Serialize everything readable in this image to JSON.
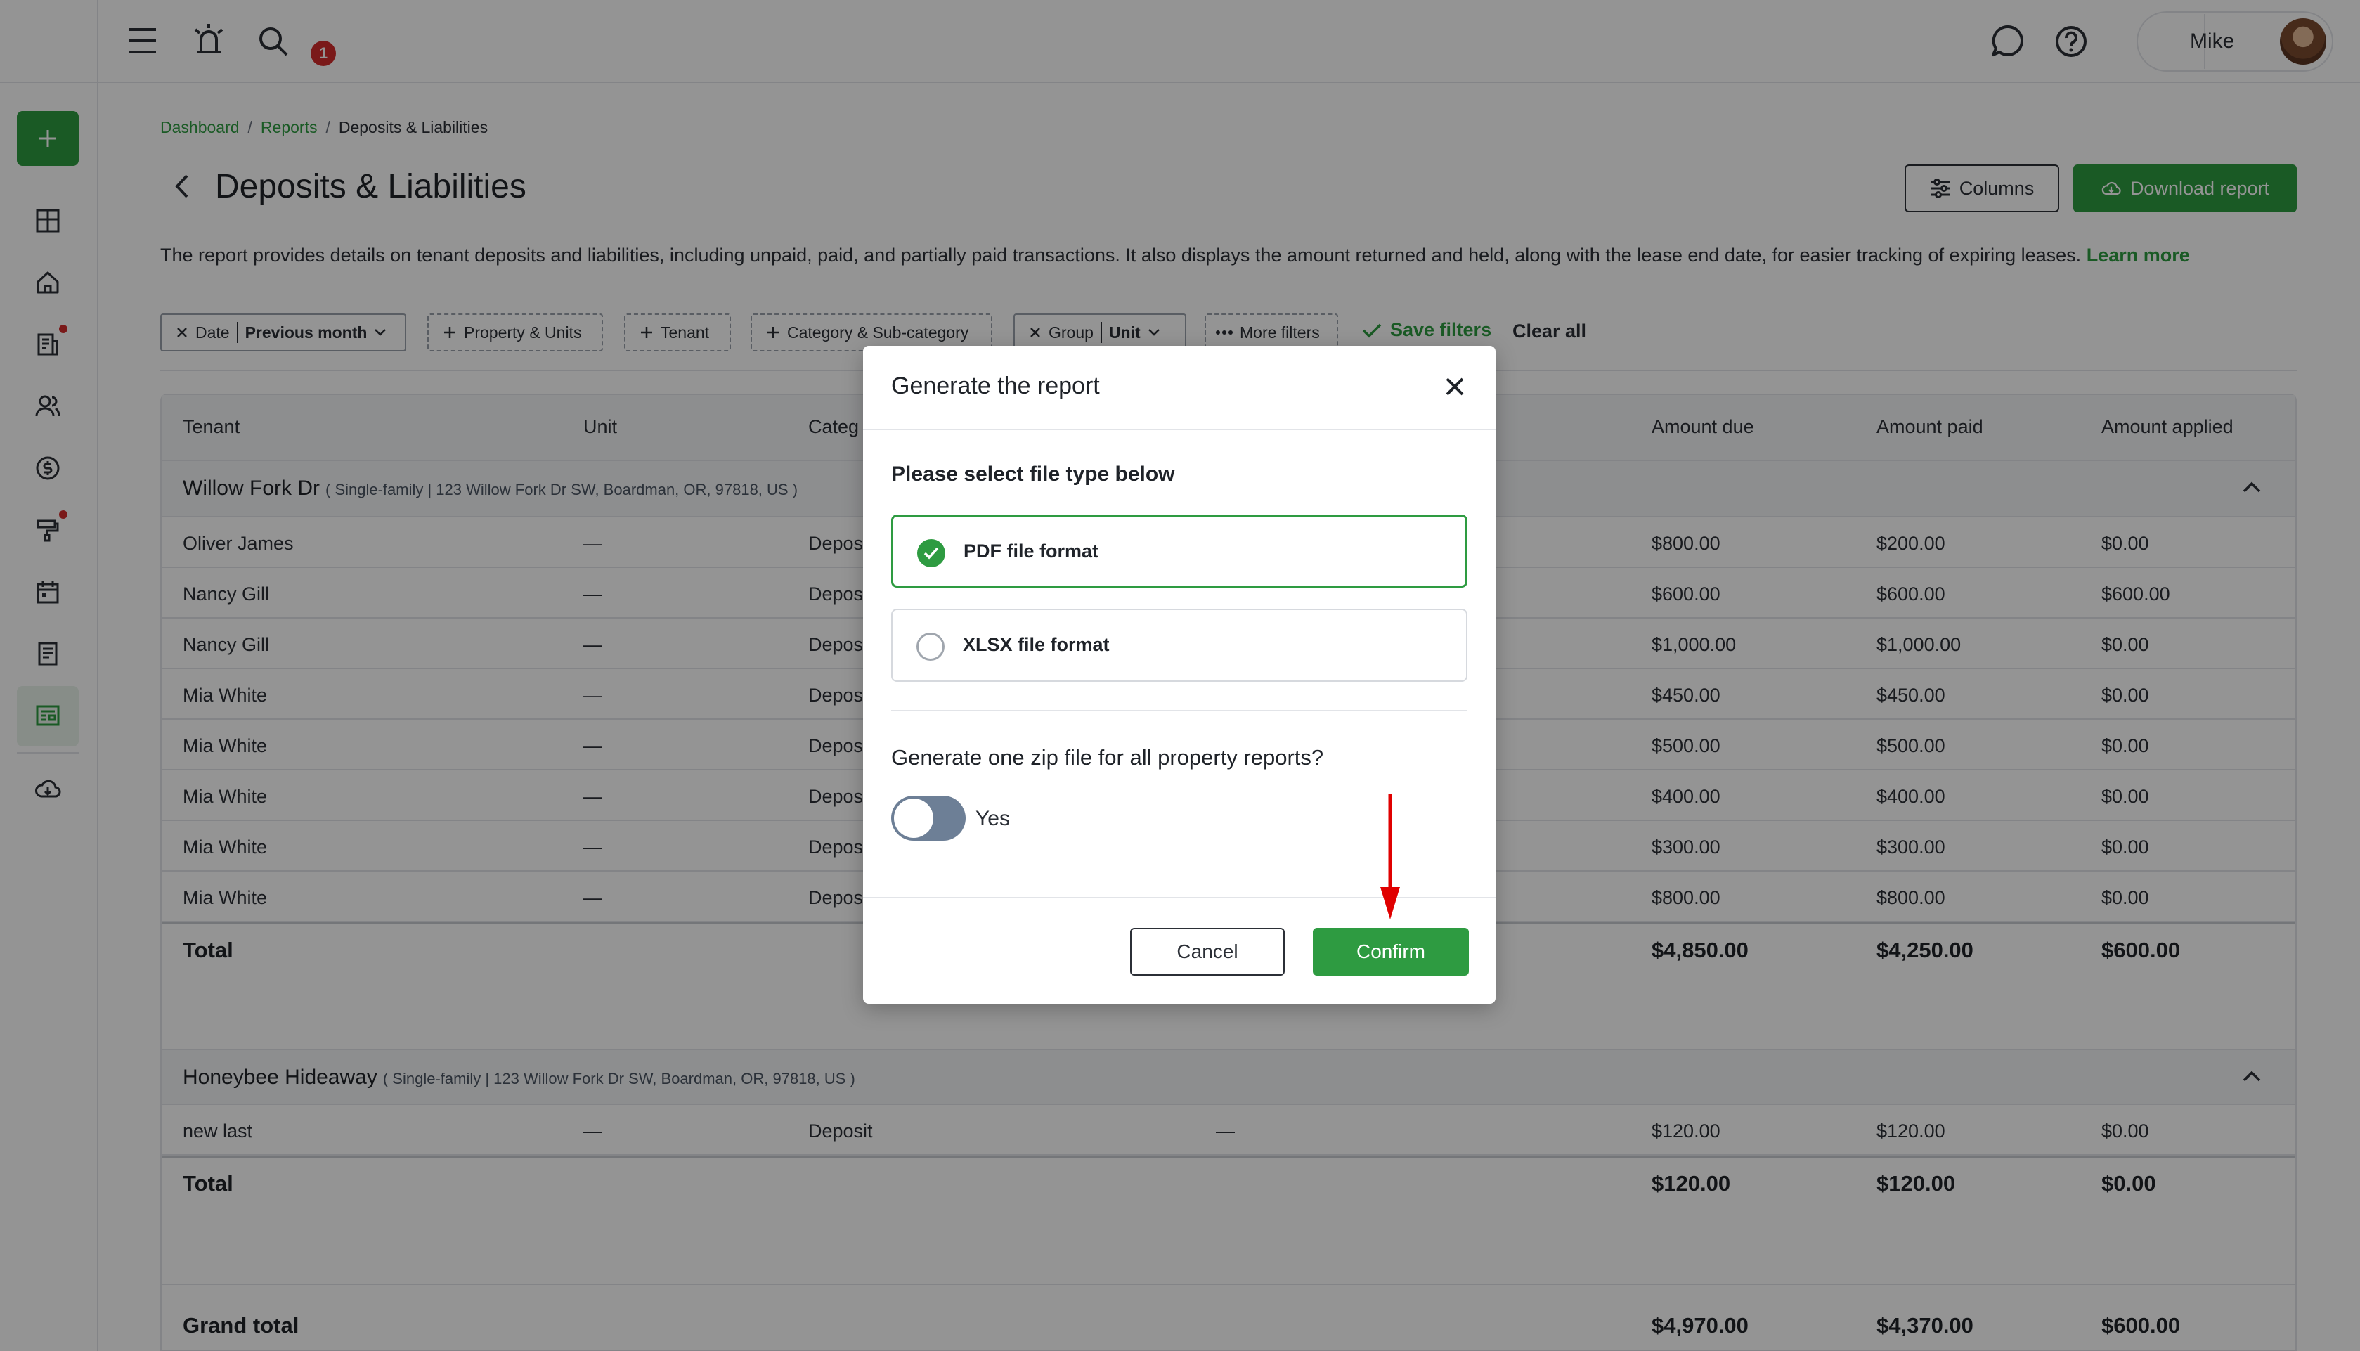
{
  "app": {
    "brand_color": "#2e9b41",
    "alert_color": "#d22b2b"
  },
  "topbar": {
    "notification_count": "1",
    "user_name": "Mike"
  },
  "sidebar": {
    "items": [
      "plus-icon",
      "dashboard-icon",
      "home-icon",
      "leases-icon",
      "people-icon",
      "money-icon",
      "maintenance-icon",
      "calendar-icon",
      "notes-icon",
      "reports-icon",
      "download-icon"
    ]
  },
  "breadcrumb": {
    "items": [
      "Dashboard",
      "Reports",
      "Deposits & Liabilities"
    ],
    "separator": "/"
  },
  "page": {
    "title": "Deposits & Liabilities",
    "columns_button": "Columns",
    "download_button": "Download report",
    "description": "The report provides details on tenant deposits and liabilities, including unpaid, paid, and partially paid transactions. It also displays the amount returned and held, along with the lease end date, for easier tracking of expiring leases.",
    "learn_more": "Learn more"
  },
  "filters": {
    "date_label": "Date",
    "date_value": "Previous month",
    "property": "Property & Units",
    "tenant": "Tenant",
    "category": "Category & Sub-category",
    "group_label": "Group",
    "group_value": "Unit",
    "more": "More filters",
    "save": "Save filters",
    "clear": "Clear all"
  },
  "table": {
    "headers": {
      "tenant": "Tenant",
      "unit": "Unit",
      "category": "Categ",
      "amount_due": "Amount due",
      "amount_paid": "Amount paid",
      "amount_applied": "Amount applied"
    },
    "groups": [
      {
        "name": "Willow Fork Dr",
        "sub": "( Single-family | 123 Willow Fork Dr SW, Boardman, OR, 97818, US )",
        "rows": [
          {
            "tenant": "Oliver James",
            "unit": "—",
            "category": "Depos",
            "due": "$800.00",
            "paid": "$200.00",
            "applied": "$0.00"
          },
          {
            "tenant": "Nancy Gill",
            "unit": "—",
            "category": "Depos",
            "due": "$600.00",
            "paid": "$600.00",
            "applied": "$600.00"
          },
          {
            "tenant": "Nancy Gill",
            "unit": "—",
            "category": "Depos",
            "due": "$1,000.00",
            "paid": "$1,000.00",
            "applied": "$0.00"
          },
          {
            "tenant": "Mia White",
            "unit": "—",
            "category": "Depos",
            "due": "$450.00",
            "paid": "$450.00",
            "applied": "$0.00"
          },
          {
            "tenant": "Mia White",
            "unit": "—",
            "category": "Depos",
            "due": "$500.00",
            "paid": "$500.00",
            "applied": "$0.00"
          },
          {
            "tenant": "Mia White",
            "unit": "—",
            "category": "Depos",
            "due": "$400.00",
            "paid": "$400.00",
            "applied": "$0.00"
          },
          {
            "tenant": "Mia White",
            "unit": "—",
            "category": "Depos",
            "due": "$300.00",
            "paid": "$300.00",
            "applied": "$0.00"
          },
          {
            "tenant": "Mia White",
            "unit": "—",
            "category": "Depos",
            "due": "$800.00",
            "paid": "$800.00",
            "applied": "$0.00"
          }
        ],
        "total": {
          "label": "Total",
          "due": "$4,850.00",
          "paid": "$4,250.00",
          "applied": "$600.00"
        }
      },
      {
        "name": "Honeybee Hideaway",
        "sub": "( Single-family | 123 Willow Fork Dr SW, Boardman, OR, 97818, US )",
        "rows": [
          {
            "tenant": "new last",
            "unit": "—",
            "category": "Deposit",
            "extra": "—",
            "due": "$120.00",
            "paid": "$120.00",
            "applied": "$0.00"
          }
        ],
        "total": {
          "label": "Total",
          "due": "$120.00",
          "paid": "$120.00",
          "applied": "$0.00"
        }
      }
    ],
    "grand_total": {
      "label": "Grand total",
      "due": "$4,970.00",
      "paid": "$4,370.00",
      "applied": "$600.00"
    }
  },
  "modal": {
    "title": "Generate the report",
    "subtitle": "Please select file type below",
    "options": [
      {
        "label": "PDF file format",
        "selected": true
      },
      {
        "label": "XLSX file format",
        "selected": false
      }
    ],
    "zip_question": "Generate one zip file for all property reports?",
    "toggle_label": "Yes",
    "toggle_on": false,
    "cancel": "Cancel",
    "confirm": "Confirm"
  },
  "annotation": {
    "arrow_color": "#e00000"
  }
}
